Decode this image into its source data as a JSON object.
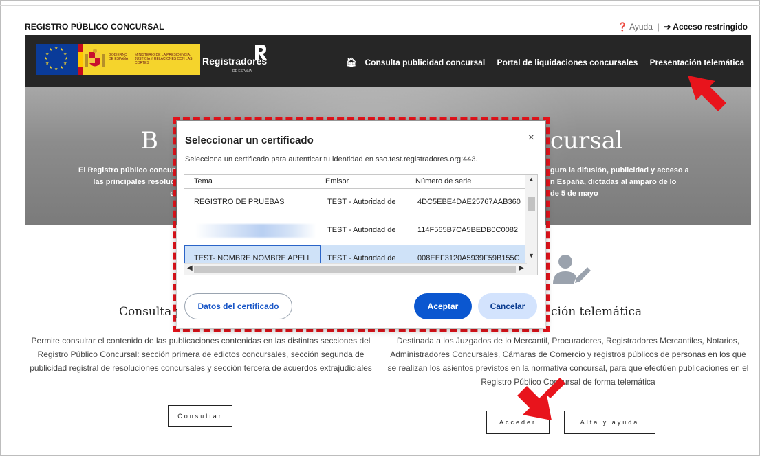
{
  "header": {
    "site_name": "REGISTRO PÚBLICO CONCURSAL",
    "help_label": "Ayuda",
    "separator": "|",
    "restricted_label": "Acceso restringido"
  },
  "navbar": {
    "logo_gob": "GOBIERNO DE ESPAÑA",
    "logo_min": "MINISTERIO DE LA PRESIDENCIA, JUSTICIA Y RELACIONES CON LAS CORTES",
    "brand_name": "Registradores",
    "brand_sub": "DE ESPAÑA",
    "menu": [
      {
        "label": "Consulta publicidad concursal"
      },
      {
        "label": "Portal de liquidaciones concursales"
      },
      {
        "label": "Presentación telemática"
      }
    ]
  },
  "hero": {
    "title_left": "B",
    "title_right": "cursal",
    "text_left_1": "El Registro público concur",
    "text_left_2": "las principales resoluc",
    "text_left_3": "d",
    "text_right_1": "gura la difusión, publicidad y acceso a",
    "text_right_2": "n España, dictadas al amparo de lo",
    "text_right_3": "de 5 de mayo"
  },
  "left_col": {
    "title": "Consulta p",
    "text": "Permite consultar el contenido de las publicaciones contenidas en las distintas secciones del Registro Público Concursal: sección primera de edictos concursales, sección segunda de publicidad registral de resoluciones concursales y sección tercera de acuerdos extrajudiciales",
    "button": "Consultar"
  },
  "right_col": {
    "title": "ción telemática",
    "text": "Destinada a los Juzgados de lo Mercantil, Procuradores, Registradores Mercantiles, Notarios, Administradores Concursales, Cámaras de Comercio y registros públicos de personas en los que se realizan los asientos previstos en la normativa concursal, para que efectúen publicaciones en el Registro Público Concursal de forma telemática",
    "button_access": "Acceder",
    "button_help": "Alta y ayuda"
  },
  "dialog": {
    "title": "Seleccionar un certificado",
    "subtitle": "Selecciona un certificado para autenticar tu identidad en sso.test.registradores.org:443.",
    "columns": [
      "Tema",
      "Emisor",
      "Número de serie"
    ],
    "rows": [
      {
        "tema": "REGISTRO DE PRUEBAS",
        "emisor": "TEST - Autoridad de",
        "serie": "4DC5EBE4DAE25767AAB360"
      },
      {
        "tema": "",
        "emisor": "TEST - Autoridad de",
        "serie": "114F565B7CA5BEDB0C0082"
      },
      {
        "tema": "TEST- NOMBRE NOMBRE APELL",
        "emisor": "TEST - Autoridad de",
        "serie": "008EEF3120A5939F59B155C"
      }
    ],
    "btn_details": "Datos del certificado",
    "btn_accept": "Aceptar",
    "btn_cancel": "Cancelar",
    "close_glyph": "×"
  },
  "colors": {
    "navbar": "#262626",
    "accent_blue": "#0b57d0",
    "highlight_red": "#e8141c",
    "selected_row": "#cfe2f8"
  }
}
